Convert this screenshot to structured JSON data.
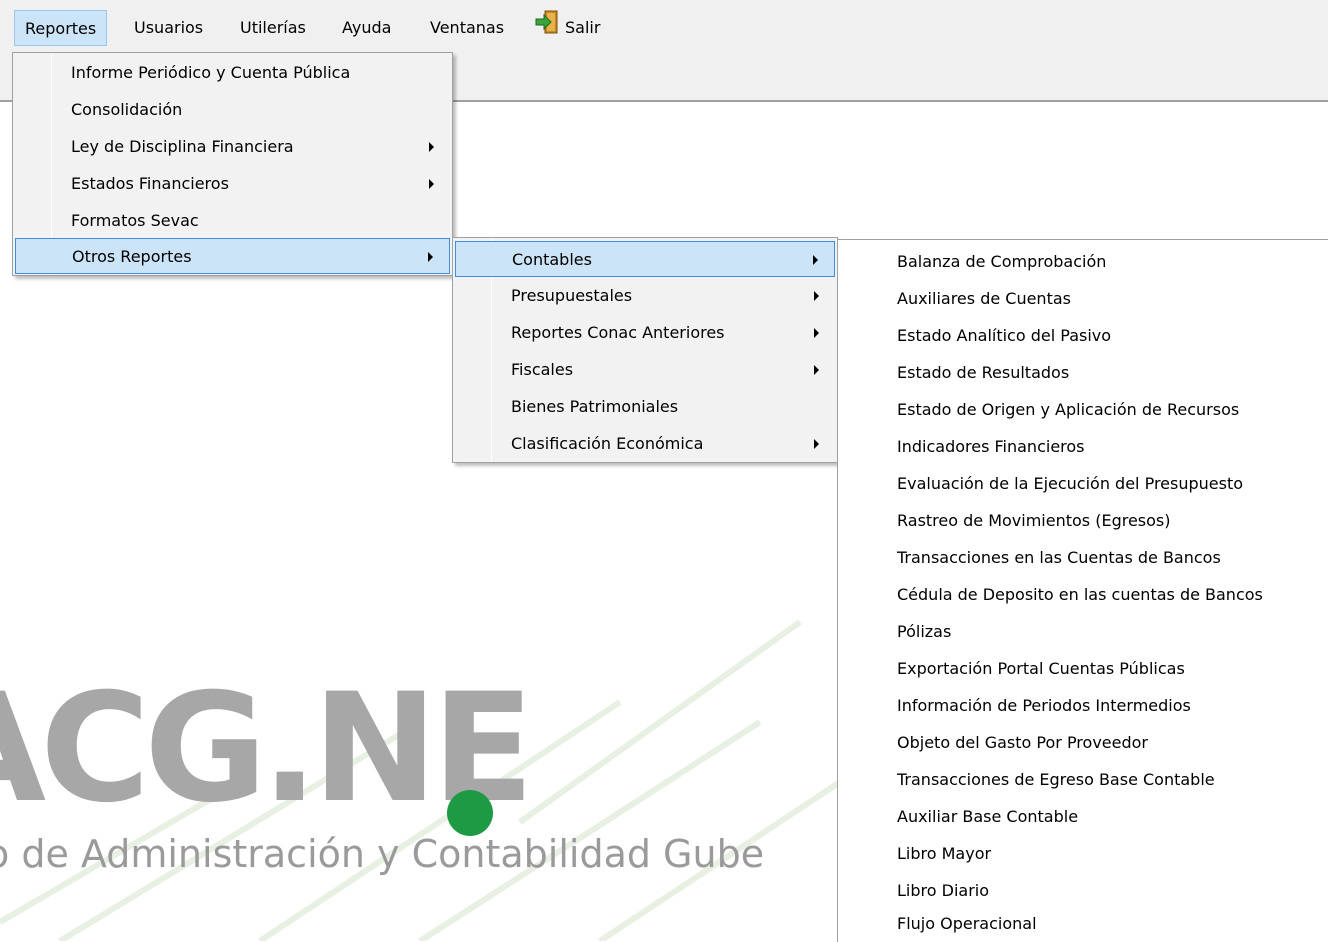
{
  "menubar": {
    "items": [
      {
        "label": "Reportes"
      },
      {
        "label": "Usuarios"
      },
      {
        "label": "Utilerías"
      },
      {
        "label": "Ayuda"
      },
      {
        "label": "Ventanas"
      },
      {
        "label": "Salir",
        "icon": "exit-door-icon"
      }
    ]
  },
  "logo": {
    "word": "ACG.NE",
    "subtitle": "o de Administración y Contabilidad Gube",
    "dot_color": "#1d9a43"
  },
  "reportes_menu": {
    "items": [
      {
        "label": "Informe Periódico y Cuenta Pública",
        "submenu": false
      },
      {
        "label": "Consolidación",
        "submenu": false
      },
      {
        "label": "Ley de Disciplina Financiera",
        "submenu": true
      },
      {
        "label": "Estados Financieros",
        "submenu": true
      },
      {
        "label": "Formatos Sevac",
        "submenu": false
      },
      {
        "label": "Otros Reportes",
        "submenu": true,
        "highlighted": true
      }
    ]
  },
  "otros_reportes_menu": {
    "items": [
      {
        "label": "Contables",
        "submenu": true,
        "highlighted": true
      },
      {
        "label": "Presupuestales",
        "submenu": true
      },
      {
        "label": "Reportes Conac Anteriores",
        "submenu": true
      },
      {
        "label": "Fiscales",
        "submenu": true
      },
      {
        "label": "Bienes Patrimoniales",
        "submenu": false
      },
      {
        "label": "Clasificación Económica",
        "submenu": true
      }
    ]
  },
  "contables_menu": {
    "items": [
      {
        "label": "Balanza de Comprobación"
      },
      {
        "label": "Auxiliares de Cuentas"
      },
      {
        "label": "Estado Analítico del Pasivo"
      },
      {
        "label": "Estado de Resultados"
      },
      {
        "label": "Estado de Origen y Aplicación de Recursos"
      },
      {
        "label": "Indicadores Financieros"
      },
      {
        "label": "Evaluación de la Ejecución del Presupuesto"
      },
      {
        "label": "Rastreo de  Movimientos (Egresos)"
      },
      {
        "label": "Transacciones en las Cuentas de Bancos"
      },
      {
        "label": "Cédula de Deposito en las cuentas de Bancos"
      },
      {
        "label": "Pólizas"
      },
      {
        "label": "Exportación Portal Cuentas Públicas"
      },
      {
        "label": "Información de Periodos Intermedios"
      },
      {
        "label": "Objeto del Gasto Por Proveedor"
      },
      {
        "label": "Transacciones de Egreso Base Contable"
      },
      {
        "label": "Auxiliar Base Contable"
      },
      {
        "label": "Libro Mayor"
      },
      {
        "label": "Libro Diario"
      },
      {
        "label": "Flujo Operacional"
      }
    ]
  }
}
